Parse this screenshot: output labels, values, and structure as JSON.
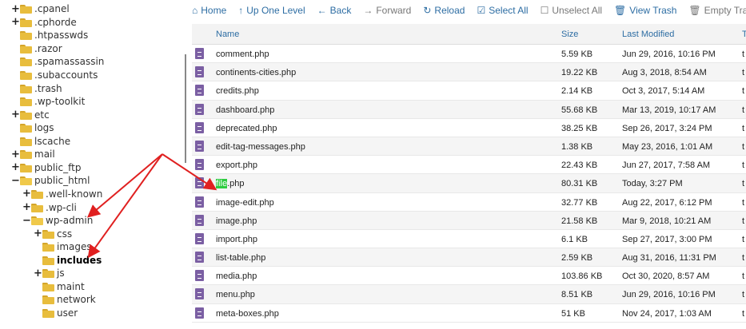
{
  "tree": [
    {
      "label": ".cpanel",
      "toggle": "+",
      "depth": 0,
      "bold": false
    },
    {
      "label": ".cphorde",
      "toggle": "+",
      "depth": 0,
      "bold": false
    },
    {
      "label": ".htpasswds",
      "toggle": "",
      "depth": 0,
      "bold": false
    },
    {
      "label": ".razor",
      "toggle": "",
      "depth": 0,
      "bold": false
    },
    {
      "label": ".spamassassin",
      "toggle": "",
      "depth": 0,
      "bold": false
    },
    {
      "label": ".subaccounts",
      "toggle": "",
      "depth": 0,
      "bold": false
    },
    {
      "label": ".trash",
      "toggle": "",
      "depth": 0,
      "bold": false
    },
    {
      "label": ".wp-toolkit",
      "toggle": "",
      "depth": 0,
      "bold": false
    },
    {
      "label": "etc",
      "toggle": "+",
      "depth": 0,
      "bold": false
    },
    {
      "label": "logs",
      "toggle": "",
      "depth": 0,
      "bold": false
    },
    {
      "label": "lscache",
      "toggle": "",
      "depth": 0,
      "bold": false
    },
    {
      "label": "mail",
      "toggle": "+",
      "depth": 0,
      "bold": false
    },
    {
      "label": "public_ftp",
      "toggle": "+",
      "depth": 0,
      "bold": false
    },
    {
      "label": "public_html",
      "toggle": "−",
      "depth": 0,
      "bold": false
    },
    {
      "label": ".well-known",
      "toggle": "+",
      "depth": 1,
      "bold": false
    },
    {
      "label": ".wp-cli",
      "toggle": "+",
      "depth": 1,
      "bold": false
    },
    {
      "label": "wp-admin",
      "toggle": "−",
      "depth": 1,
      "bold": false
    },
    {
      "label": "css",
      "toggle": "+",
      "depth": 2,
      "bold": false
    },
    {
      "label": "images",
      "toggle": "",
      "depth": 2,
      "bold": false
    },
    {
      "label": "includes",
      "toggle": "",
      "depth": 2,
      "bold": true
    },
    {
      "label": "js",
      "toggle": "+",
      "depth": 2,
      "bold": false
    },
    {
      "label": "maint",
      "toggle": "",
      "depth": 2,
      "bold": false
    },
    {
      "label": "network",
      "toggle": "",
      "depth": 2,
      "bold": false
    },
    {
      "label": "user",
      "toggle": "",
      "depth": 2,
      "bold": false
    }
  ],
  "toolbar": [
    {
      "label": "Home",
      "icon": "home-icon",
      "glyph": "⌂",
      "enabled": true
    },
    {
      "label": "Up One Level",
      "icon": "up-arrow-icon",
      "glyph": "↑",
      "enabled": true
    },
    {
      "label": "Back",
      "icon": "back-arrow-icon",
      "glyph": "←",
      "enabled": true
    },
    {
      "label": "Forward",
      "icon": "forward-arrow-icon",
      "glyph": "→",
      "enabled": false
    },
    {
      "label": "Reload",
      "icon": "reload-icon",
      "glyph": "↻",
      "enabled": true
    },
    {
      "label": "Select All",
      "icon": "checkbox-checked-icon",
      "glyph": "☑",
      "enabled": true
    },
    {
      "label": "Unselect All",
      "icon": "checkbox-empty-icon",
      "glyph": "☐",
      "enabled": false
    },
    {
      "label": "View Trash",
      "icon": "trash-icon",
      "glyph": "🗑",
      "enabled": true
    },
    {
      "label": "Empty Trash",
      "icon": "empty-trash-icon",
      "glyph": "🗑",
      "enabled": false
    }
  ],
  "table": {
    "headers": {
      "name": "Name",
      "size": "Size",
      "modified": "Last Modified",
      "type": "T"
    },
    "rows": [
      {
        "pre": "",
        "hl": "",
        "post": "comment.php",
        "size": "5.59 KB",
        "modified": "Jun 29, 2016, 10:16 PM",
        "type": "t"
      },
      {
        "pre": "",
        "hl": "",
        "post": "continents-cities.php",
        "size": "19.22 KB",
        "modified": "Aug 3, 2018, 8:54 AM",
        "type": "t"
      },
      {
        "pre": "",
        "hl": "",
        "post": "credits.php",
        "size": "2.14 KB",
        "modified": "Oct 3, 2017, 5:14 AM",
        "type": "t"
      },
      {
        "pre": "",
        "hl": "",
        "post": "dashboard.php",
        "size": "55.68 KB",
        "modified": "Mar 13, 2019, 10:17 AM",
        "type": "t"
      },
      {
        "pre": "",
        "hl": "",
        "post": "deprecated.php",
        "size": "38.25 KB",
        "modified": "Sep 26, 2017, 3:24 PM",
        "type": "t"
      },
      {
        "pre": "",
        "hl": "",
        "post": "edit-tag-messages.php",
        "size": "1.38 KB",
        "modified": "May 23, 2016, 1:01 AM",
        "type": "t"
      },
      {
        "pre": "",
        "hl": "",
        "post": "export.php",
        "size": "22.43 KB",
        "modified": "Jun 27, 2017, 7:58 AM",
        "type": "t"
      },
      {
        "pre": "",
        "hl": "file",
        "post": ".php",
        "size": "80.31 KB",
        "modified": "Today, 3:27 PM",
        "type": "t"
      },
      {
        "pre": "",
        "hl": "",
        "post": "image-edit.php",
        "size": "32.77 KB",
        "modified": "Aug 22, 2017, 6:12 PM",
        "type": "t"
      },
      {
        "pre": "",
        "hl": "",
        "post": "image.php",
        "size": "21.58 KB",
        "modified": "Mar 9, 2018, 10:21 AM",
        "type": "t"
      },
      {
        "pre": "",
        "hl": "",
        "post": "import.php",
        "size": "6.1 KB",
        "modified": "Sep 27, 2017, 3:00 PM",
        "type": "t"
      },
      {
        "pre": "",
        "hl": "",
        "post": "list-table.php",
        "size": "2.59 KB",
        "modified": "Aug 31, 2016, 11:31 PM",
        "type": "t"
      },
      {
        "pre": "",
        "hl": "",
        "post": "media.php",
        "size": "103.86 KB",
        "modified": "Oct 30, 2020, 8:57 AM",
        "type": "t"
      },
      {
        "pre": "",
        "hl": "",
        "post": "menu.php",
        "size": "8.51 KB",
        "modified": "Jun 29, 2016, 10:16 PM",
        "type": "t"
      },
      {
        "pre": "",
        "hl": "",
        "post": "meta-boxes.php",
        "size": "51 KB",
        "modified": "Nov 24, 2017, 1:03 AM",
        "type": "t"
      }
    ]
  },
  "colors": {
    "link": "#2d6da3",
    "folder": "#e8bd3d",
    "file_icon": "#7b5fa3",
    "highlight": "#2ecc40",
    "annotation_arrow": "#e02020"
  }
}
